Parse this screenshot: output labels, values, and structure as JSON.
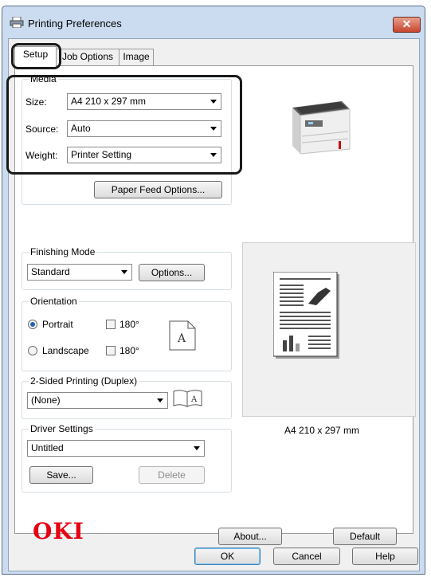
{
  "window": {
    "title": "Printing Preferences",
    "close_label": "✕"
  },
  "tabs": [
    {
      "label": "Setup",
      "active": true
    },
    {
      "label": "Job Options",
      "active": false
    },
    {
      "label": "Image",
      "active": false
    }
  ],
  "media": {
    "group_label": "Media",
    "size_label": "Size:",
    "size_value": "A4 210 x 297 mm",
    "source_label": "Source:",
    "source_value": "Auto",
    "weight_label": "Weight:",
    "weight_value": "Printer Setting",
    "paper_feed_button": "Paper Feed Options..."
  },
  "finishing": {
    "group_label": "Finishing Mode",
    "mode_value": "Standard",
    "options_button": "Options..."
  },
  "orientation": {
    "group_label": "Orientation",
    "portrait_label": "Portrait",
    "portrait_selected": true,
    "landscape_label": "Landscape",
    "landscape_selected": false,
    "rotate_label_1": "180°",
    "rotate_label_2": "180°",
    "rotate_checked_1": false,
    "rotate_checked_2": false,
    "page_glyph": "A"
  },
  "duplex": {
    "group_label": "2-Sided Printing (Duplex)",
    "value": "(None)",
    "glyph": "A"
  },
  "driver_settings": {
    "group_label": "Driver Settings",
    "value": "Untitled",
    "save_button": "Save...",
    "delete_button": "Delete"
  },
  "preview": {
    "paper_size_caption": "A4 210 x 297 mm"
  },
  "brand": {
    "logo_text": "OKI",
    "color": "#e60012"
  },
  "panel_buttons": {
    "about": "About...",
    "default": "Default"
  },
  "dialog_buttons": {
    "ok": "OK",
    "cancel": "Cancel",
    "help": "Help"
  },
  "colors": {
    "accent": "#1f62b3",
    "window_frame": "#cbdcf0",
    "close_button": "#c7452e"
  }
}
